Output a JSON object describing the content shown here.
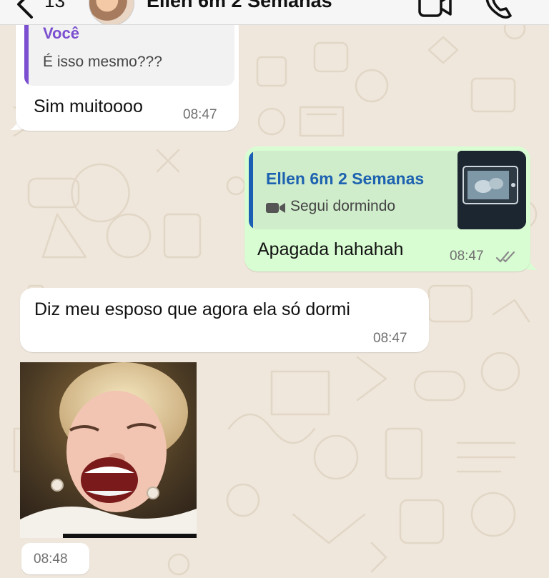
{
  "header": {
    "back_count": "13",
    "contact_name": "Ellen 6m 2 Semanas",
    "icons": [
      "chevron-left-icon",
      "video-call-icon",
      "phone-icon"
    ]
  },
  "messages": [
    {
      "direction": "incoming",
      "quote": {
        "author": "Você",
        "text": "É isso mesmo???"
      },
      "text": "Sim muitoooo",
      "time": "08:47"
    },
    {
      "direction": "outgoing",
      "quote": {
        "author": "Ellen 6m 2 Semanas",
        "media_label": "Segui dormindo",
        "media_icon": "video-icon"
      },
      "text": "Apagada hahahah",
      "time": "08:47",
      "status_icon": "double-check-icon"
    },
    {
      "direction": "incoming",
      "text": "Diz meu esposo que agora ela só dormi",
      "time": "08:47"
    },
    {
      "direction": "incoming",
      "type": "sticker",
      "time": "08:48"
    }
  ],
  "colors": {
    "background": "#efe7dc",
    "incoming_bubble": "#ffffff",
    "outgoing_bubble": "#d9fdd3",
    "quote_you_accent": "#7b4fcf",
    "quote_contact_accent": "#1a5fb4",
    "quote_contact_name": "#1d62b0",
    "read_tick": "#8a8a8a"
  }
}
